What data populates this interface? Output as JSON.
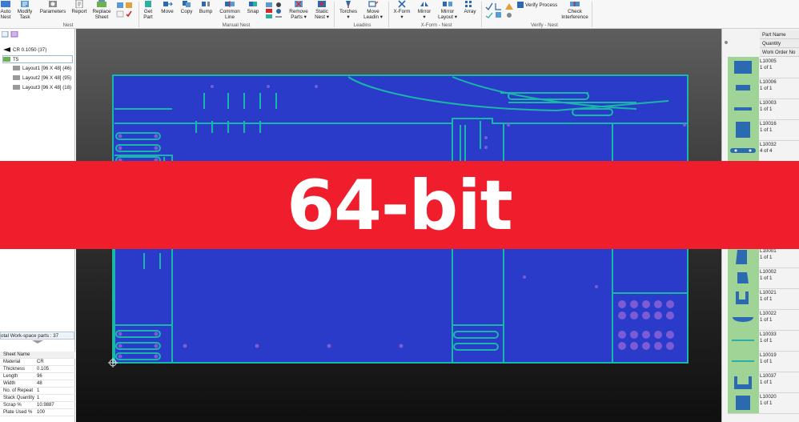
{
  "colors": {
    "plate": "#2a3bc9",
    "part_outline": "#19b7a8",
    "banner": "#f01d2c",
    "part_thumb": "#9fd496"
  },
  "ribbon": {
    "buttons": {
      "auto_nest": "Auto\nNest",
      "modify_task": "Modify\nTask",
      "parameters": "Parameters",
      "report": "Report",
      "replace_sheet": "Replace\nSheet",
      "get_part": "Get\nPart",
      "move": "Move",
      "copy": "Copy",
      "bump": "Bump",
      "common_line": "Common\nLine",
      "snap": "Snap",
      "remove_parts": "Remove\nParts ▾",
      "static_nest": "Static\nNest ▾",
      "torches": "Torches\n▾",
      "move_leadin": "Move\nLeadin ▾",
      "x_form": "X-Form\n▾",
      "mirror": "Mirror\n▾",
      "mirror_layout": "Mirror\nLayout ▾",
      "array": "Array",
      "verify_process": "Verify Process",
      "check_interference": "Check\nInterference"
    },
    "groups": {
      "nest": "Nest",
      "manual_nest": "Manual Nest",
      "leadins": "Leadins",
      "xform_nest": "X-Form - Nest",
      "verify_nest": "Verify - Nest"
    }
  },
  "tree": {
    "items": [
      {
        "label": "CR 0.1050 (37)"
      },
      {
        "label": "T5"
      },
      {
        "label": "Layout1 [96 X 48]  (46)"
      },
      {
        "label": "Layout2 [96 X 48]  (95)"
      },
      {
        "label": "Layout3 [96 X 48]  (18)"
      }
    ],
    "total": "otal Work-space parts : 37"
  },
  "properties": {
    "header": "Sheet Name",
    "rows": [
      {
        "k": "Material",
        "v": "CR"
      },
      {
        "k": "Thickness",
        "v": "0.105"
      },
      {
        "k": "Length",
        "v": "96"
      },
      {
        "k": "Width",
        "v": "48"
      },
      {
        "k": "No. of Repeat",
        "v": "1"
      },
      {
        "k": "Stack Quantity",
        "v": "1"
      },
      {
        "k": "Scrap %",
        "v": "10.9887"
      },
      {
        "k": "Plate Used %",
        "v": "100"
      }
    ]
  },
  "parts_panel": {
    "headers": [
      "Part Name",
      "Quantity",
      "Work Order No"
    ],
    "parts": [
      {
        "name": "L10005",
        "qty": "1 of 1"
      },
      {
        "name": "L10006",
        "qty": "1 of 1"
      },
      {
        "name": "L10003",
        "qty": "1 of 1"
      },
      {
        "name": "L10016",
        "qty": "1 of 1"
      },
      {
        "name": "L10032",
        "qty": "4 of 4"
      },
      {
        "name": "L10001",
        "qty": "1 of 1"
      },
      {
        "name": "L10002",
        "qty": "1 of 1"
      },
      {
        "name": "L10021",
        "qty": "1 of 1"
      },
      {
        "name": "L10022",
        "qty": "1 of 1"
      },
      {
        "name": "L10033",
        "qty": "1 of 1"
      },
      {
        "name": "L10019",
        "qty": "1 of 1"
      },
      {
        "name": "L10037",
        "qty": "1 of 1"
      },
      {
        "name": "L10020",
        "qty": "1 of 1"
      }
    ]
  },
  "banner": {
    "text": "64-bit"
  }
}
